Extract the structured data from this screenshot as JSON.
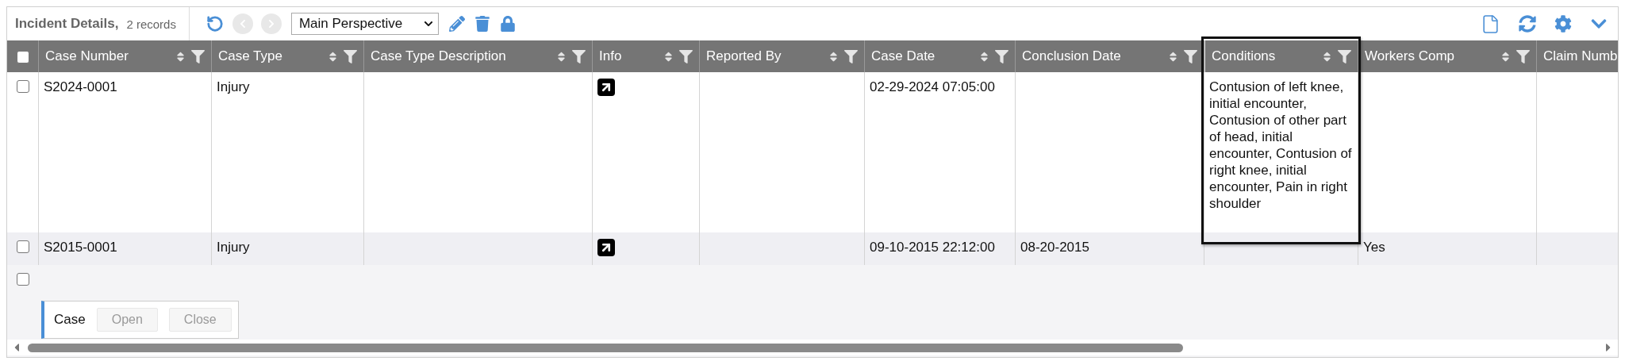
{
  "header": {
    "title": "Incident Details,",
    "record_count": "2 records"
  },
  "toolbar": {
    "back_enabled": false,
    "forward_enabled": false,
    "perspective": "Main Perspective"
  },
  "table": {
    "all_selected": false,
    "columns": [
      {
        "name": "Case Number",
        "kind": "text",
        "outlined": false
      },
      {
        "name": "Case Type",
        "kind": "text",
        "outlined": false
      },
      {
        "name": "Case Type Description",
        "kind": "text",
        "outlined": false
      },
      {
        "name": "Info",
        "kind": "link",
        "outlined": false
      },
      {
        "name": "Reported By",
        "kind": "text",
        "outlined": false
      },
      {
        "name": "Case Date",
        "kind": "text",
        "outlined": false
      },
      {
        "name": "Conclusion Date",
        "kind": "text",
        "outlined": false
      },
      {
        "name": "Conditions",
        "kind": "text",
        "outlined": true
      },
      {
        "name": "Workers Comp",
        "kind": "text",
        "outlined": false
      },
      {
        "name": "Claim Numb",
        "kind": "cut",
        "outlined": false
      }
    ],
    "rows": [
      {
        "selected": false,
        "has_link": true,
        "cells": [
          "S2024-0001",
          "Injury",
          null,
          null,
          null,
          "02-29-2024 07:05:00",
          null,
          "Contusion of left knee, initial encounter, Contusion of other part of head, initial encounter, Contusion of right knee, initial encounter, Pain in right shoulder",
          null,
          null
        ]
      },
      {
        "selected": false,
        "has_link": true,
        "cells": [
          "S2015-0001",
          "Injury",
          null,
          null,
          null,
          "09-10-2015 22:12:00",
          "08-20-2015",
          null,
          "Yes",
          null
        ]
      }
    ],
    "blank_row": {
      "selected": false
    }
  },
  "action_bar": {
    "label": "Case",
    "buttons": [
      {
        "label": "Open",
        "disabled": true
      },
      {
        "label": "Close",
        "disabled": true
      }
    ]
  }
}
